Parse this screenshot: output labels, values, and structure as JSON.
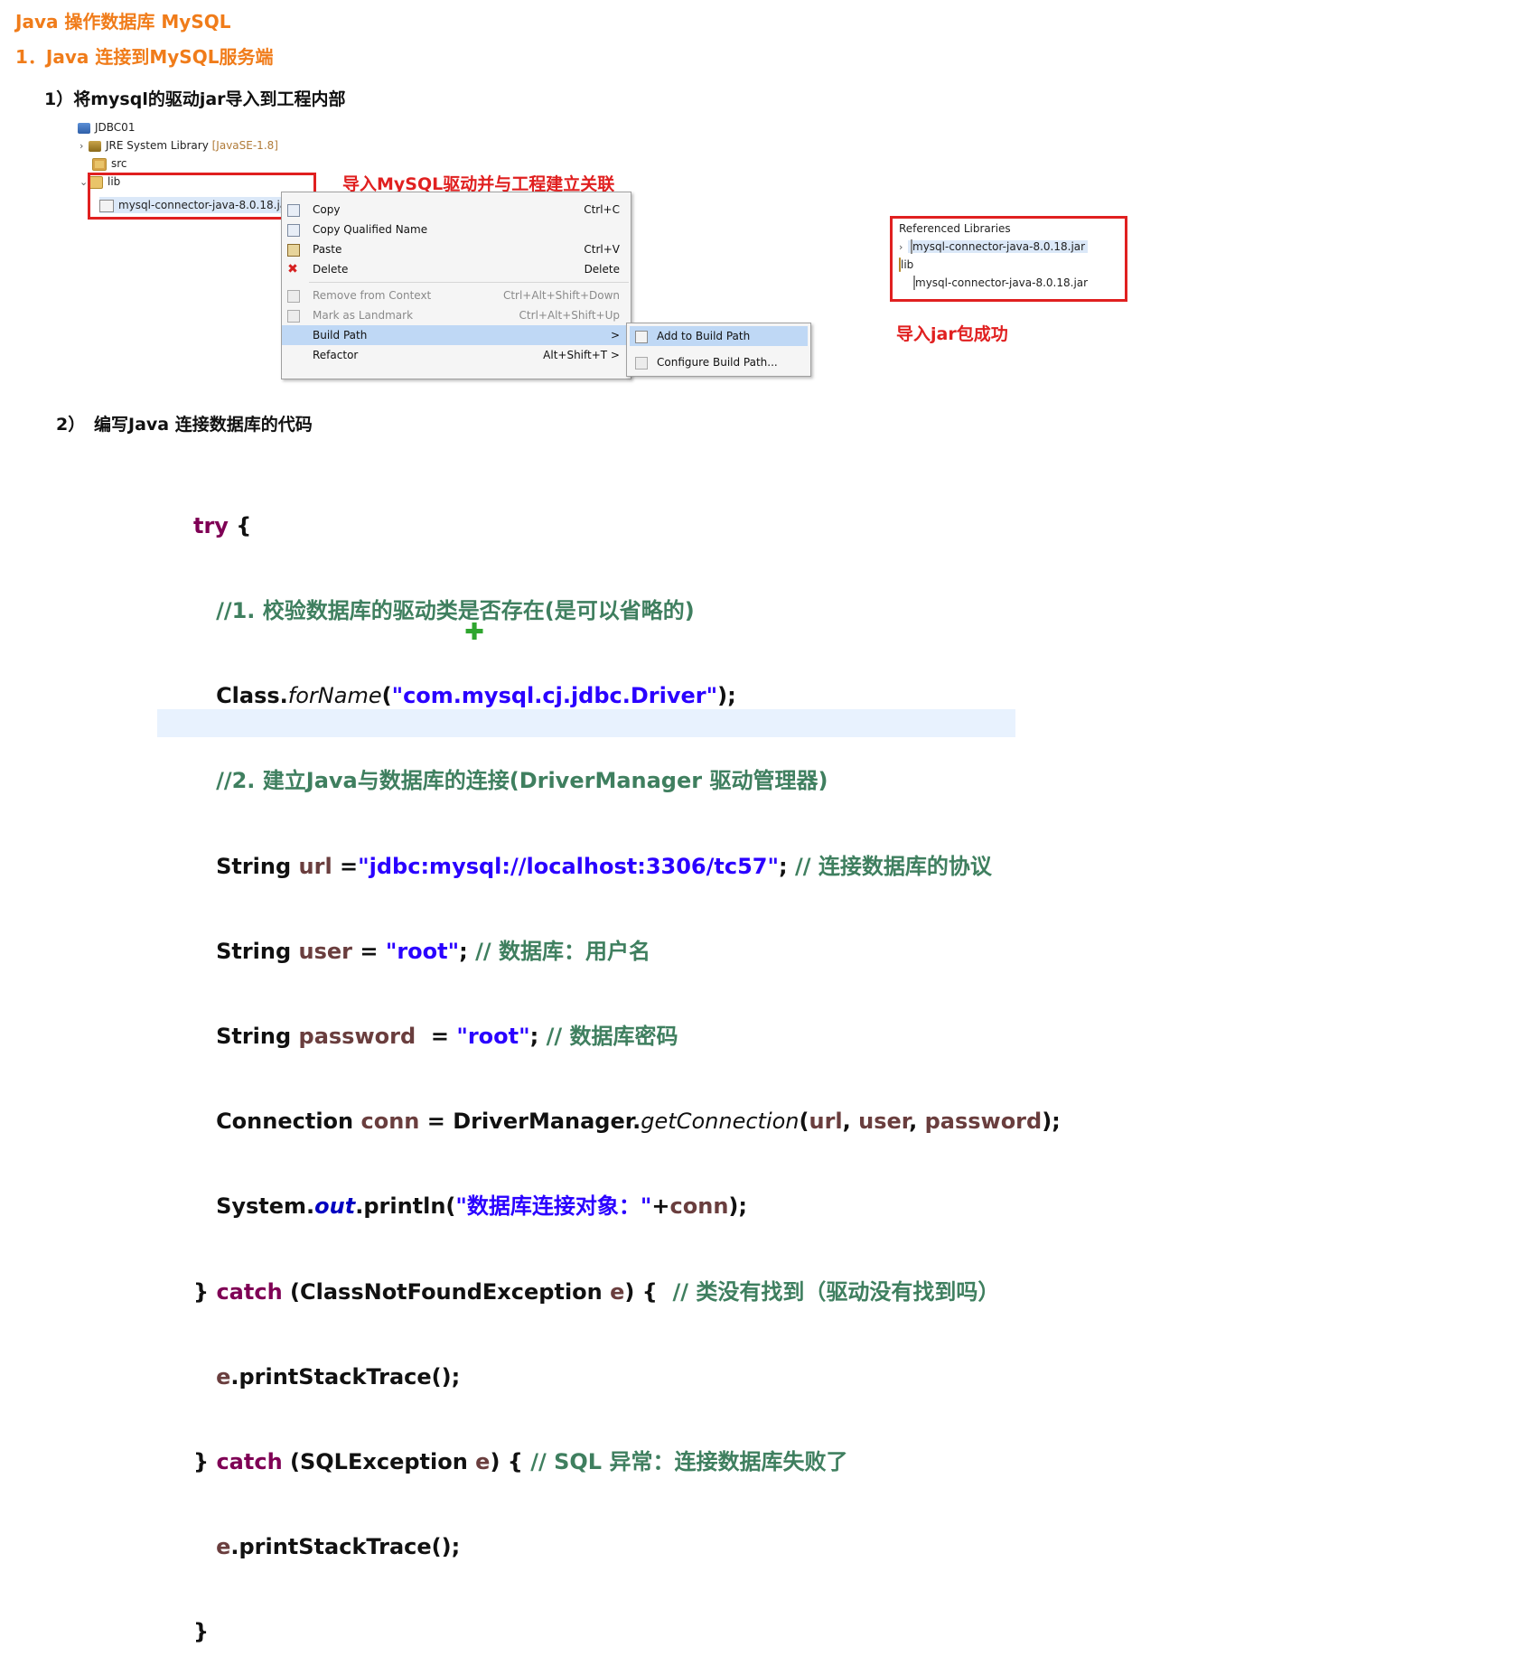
{
  "headings": {
    "title": "Java 操作数据库 MySQL",
    "section1": "1．Java 连接到MySQL服务端",
    "step1": "1）将mysql的驱动jar导入到工程内部",
    "step2_num": "2）",
    "step2_text": "编写Java 连接数据库的代码"
  },
  "project_tree": {
    "project": "JDBC01",
    "jre_label": "JRE System Library",
    "jre_version": "[JavaSE-1.8]",
    "src": "src",
    "lib": "lib",
    "jar": "mysql-connector-java-8.0.18.jar"
  },
  "annotations": {
    "link_driver": "导入MySQL驱动并与工程建立关联",
    "jar_success": "导入jar包成功"
  },
  "context_menu": {
    "items": [
      {
        "label": "Copy",
        "shortcut": "Ctrl+C"
      },
      {
        "label": "Copy Qualified Name",
        "shortcut": ""
      },
      {
        "label": "Paste",
        "shortcut": "Ctrl+V"
      },
      {
        "label": "Delete",
        "shortcut": "Delete"
      },
      {
        "label": "Remove from Context",
        "shortcut": "Ctrl+Alt+Shift+Down"
      },
      {
        "label": "Mark as Landmark",
        "shortcut": "Ctrl+Alt+Shift+Up"
      },
      {
        "label": "Build Path",
        "shortcut": ">"
      },
      {
        "label": "Refactor",
        "shortcut": "Alt+Shift+T >"
      }
    ],
    "submenu": [
      {
        "label": "Add to Build Path"
      },
      {
        "label": "Configure Build Path..."
      }
    ]
  },
  "referenced_panel": {
    "ref_libs": "Referenced Libraries",
    "ref_jar": "mysql-connector-java-8.0.18.jar",
    "lib": "lib",
    "lib_jar": "mysql-connector-java-8.0.18.jar"
  },
  "code": {
    "l1_kw": "try",
    "l1_rest": " {",
    "l2": "   //1. 校验数据库的驱动类是否存在(是可以省略的)",
    "l3_a": "   Class.",
    "l3_b": "forName",
    "l3_c": "(",
    "l3_str": "\"com.mysql.cj.jdbc.Driver\"",
    "l3_d": ");",
    "l4": "   //2. 建立Java与数据库的连接(DriverManager 驱动管理器)",
    "l5_a": "   String ",
    "l5_var": "url",
    "l5_b": " =",
    "l5_str": "\"jdbc:mysql://localhost:3306/tc57\"",
    "l5_c": "; ",
    "l5_cm": "// 连接数据库的协议",
    "l6_a": "   String ",
    "l6_var": "user",
    "l6_b": " = ",
    "l6_str": "\"root\"",
    "l6_c": "; ",
    "l6_cm": "// 数据库：用户名",
    "l7_a": "   String ",
    "l7_var": "password",
    "l7_b": "  = ",
    "l7_str": "\"root\"",
    "l7_c": "; ",
    "l7_cm": "// 数据库密码",
    "l8_a": "   Connection ",
    "l8_var": "conn",
    "l8_b": " = DriverManager.",
    "l8_it": "getConnection",
    "l8_c": "(",
    "l8_v1": "url",
    "l8_d": ", ",
    "l8_v2": "user",
    "l8_e": ", ",
    "l8_v3": "password",
    "l8_f": ");",
    "l9_a": "   System.",
    "l9_it": "out",
    "l9_b": ".println(",
    "l9_str": "\"数据库连接对象：\"",
    "l9_c": "+",
    "l9_var": "conn",
    "l9_d": ");",
    "l10_a": "} ",
    "l10_kw": "catch",
    "l10_b": " (ClassNotFoundException ",
    "l10_var": "e",
    "l10_c": ") {  ",
    "l10_cm": "// 类没有找到（驱动没有找到吗）",
    "l11_var": "   e",
    "l11_a": ".printStackTrace();",
    "l12_a": "} ",
    "l12_kw": "catch",
    "l12_b": " (SQLException ",
    "l12_var": "e",
    "l12_c": ") { ",
    "l12_cm": "// SQL 异常：连接数据库失败了",
    "l13_var": "   e",
    "l13_a": ".printStackTrace();",
    "l14": "}"
  }
}
